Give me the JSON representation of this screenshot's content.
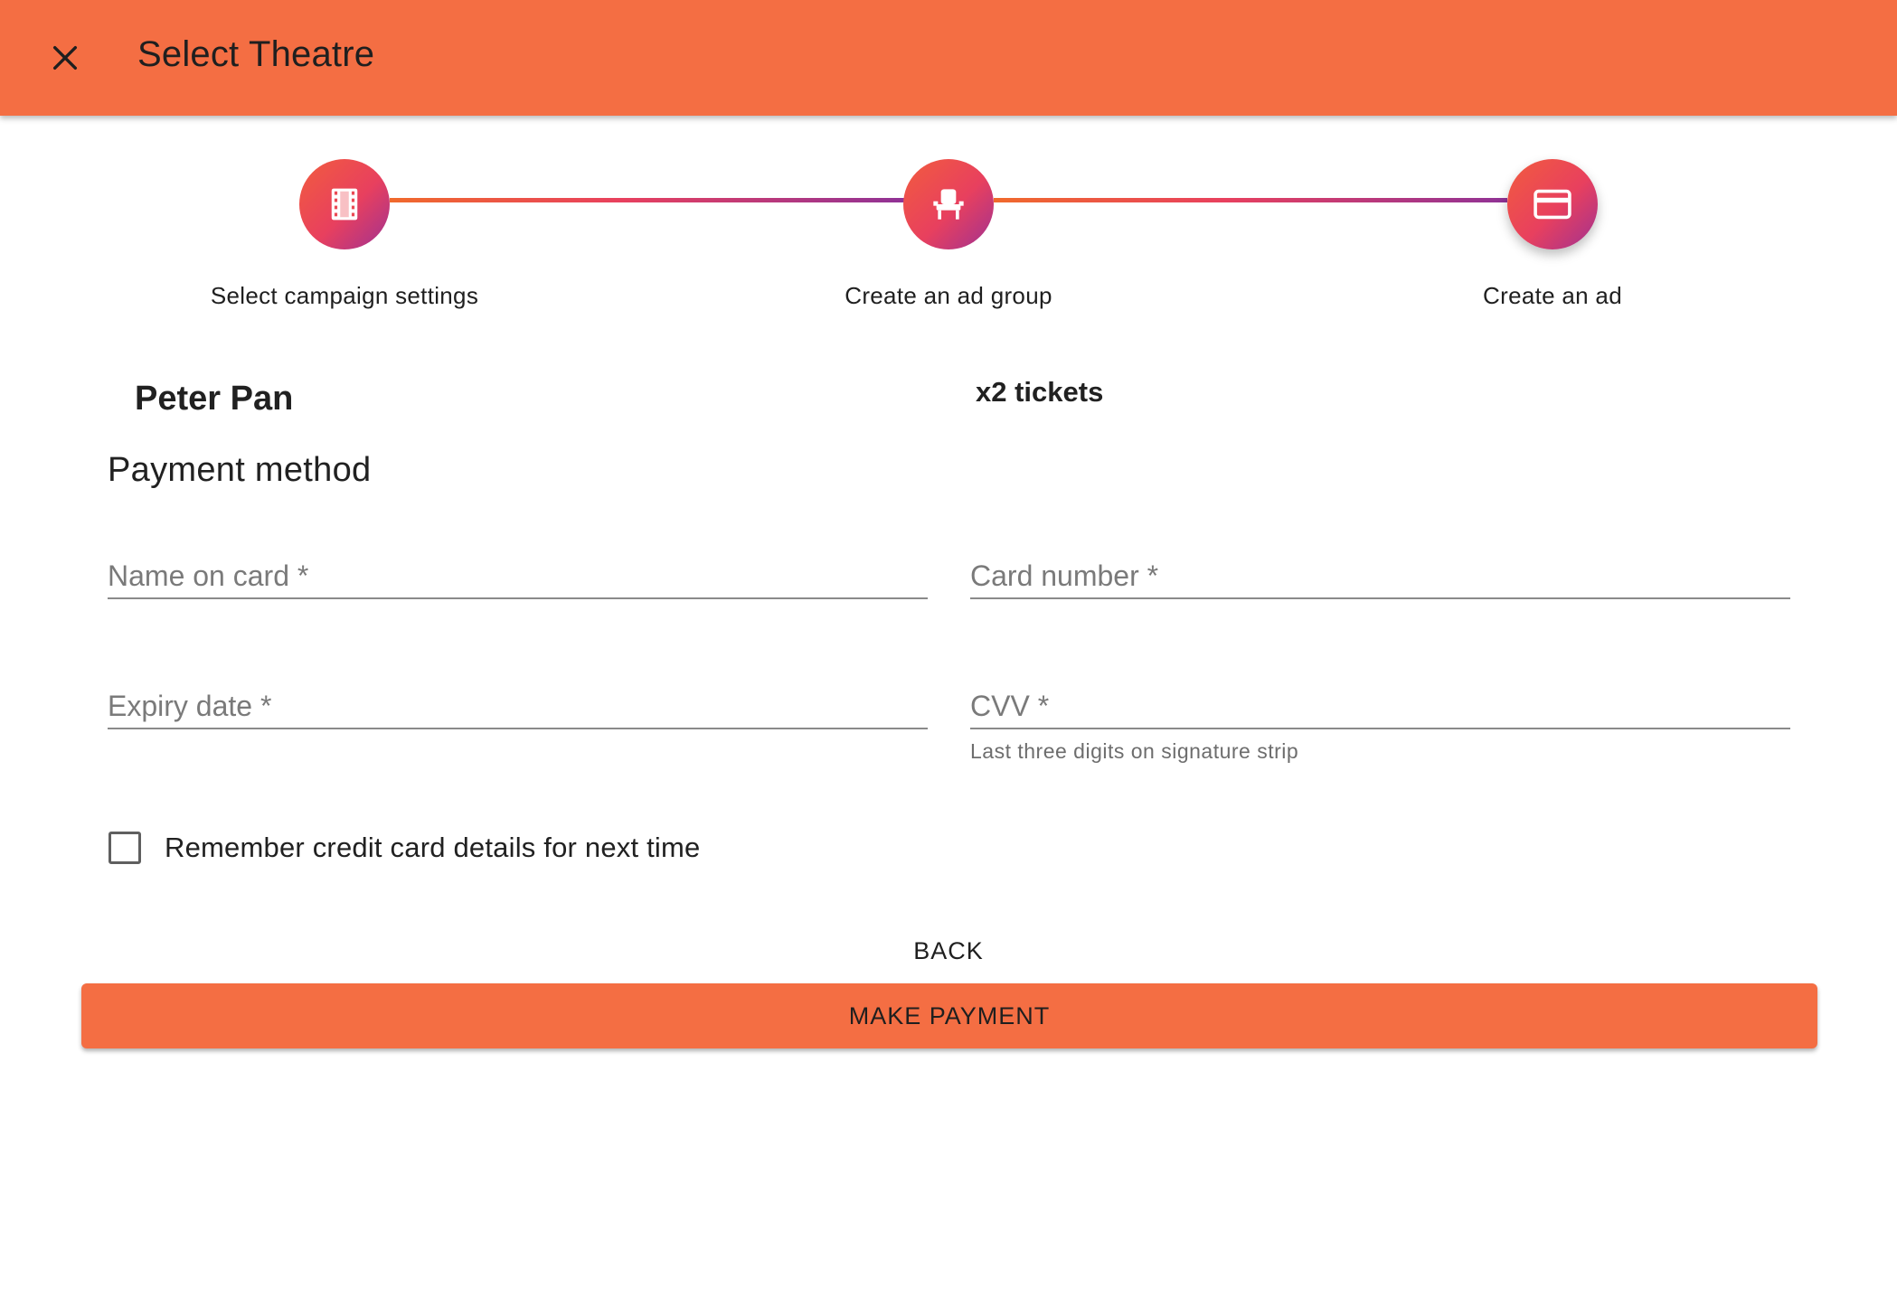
{
  "appbar": {
    "close_icon": "close-icon",
    "title": "Select Theatre",
    "color": "#f46e43"
  },
  "stepper": {
    "steps": [
      {
        "label": "Select campaign settings",
        "icon": "film-icon"
      },
      {
        "label": "Create an ad group",
        "icon": "seat-icon"
      },
      {
        "label": "Create an ad",
        "icon": "credit-card-icon"
      }
    ],
    "active_step": 3
  },
  "summary": {
    "show": "Peter Pan",
    "tickets": "x2 tickets"
  },
  "payment": {
    "section_title": "Payment method",
    "name_on_card": {
      "placeholder": "Name on card *",
      "value": ""
    },
    "card_number": {
      "placeholder": "Card number *",
      "value": ""
    },
    "expiry_date": {
      "placeholder": "Expiry date *",
      "value": ""
    },
    "cvv": {
      "placeholder": "CVV *",
      "value": "",
      "helper": "Last three digits on signature strip"
    },
    "remember_label": "Remember credit card details for next time",
    "remember_checked": false
  },
  "actions": {
    "back_label": "BACK",
    "pay_label": "MAKE PAYMENT"
  }
}
